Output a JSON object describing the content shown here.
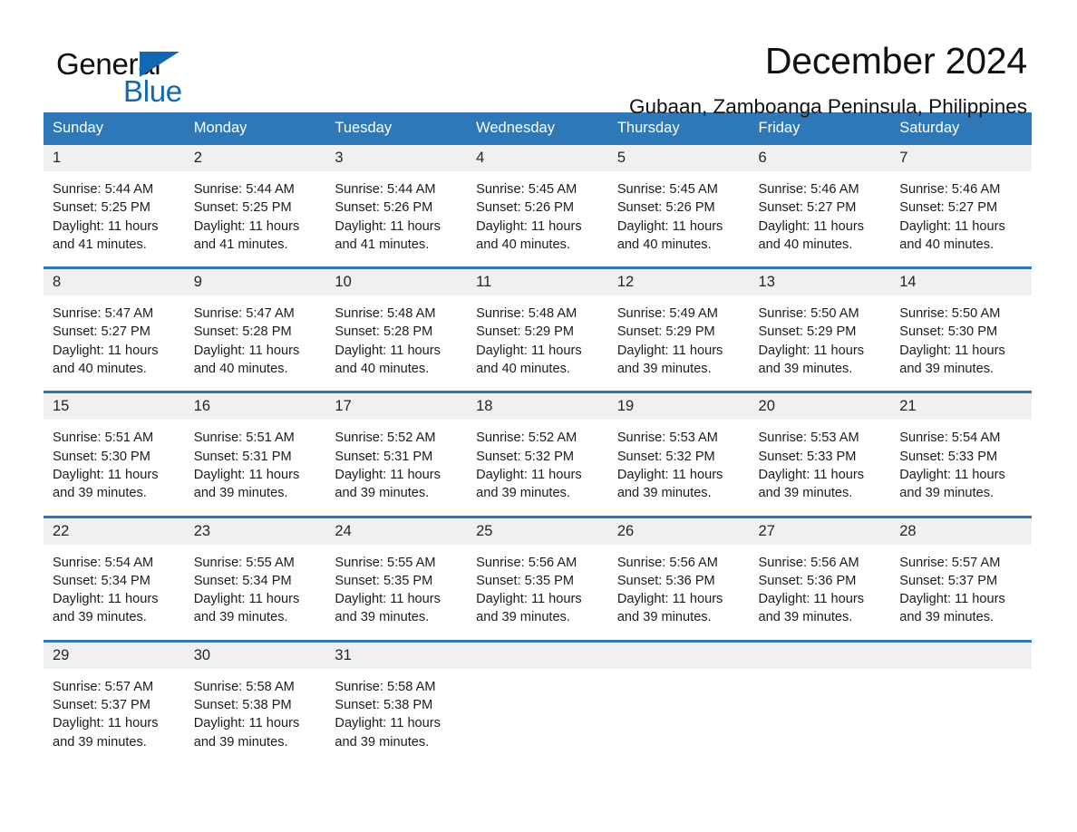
{
  "brand": {
    "word_one": "General",
    "word_two": "Blue",
    "accent_color": "#1268b3"
  },
  "header": {
    "title": "December 2024",
    "subtitle": "Gubaan, Zamboanga Peninsula, Philippines"
  },
  "theme": {
    "header_blue": "#2e78b8",
    "date_band_gray": "#f0f0f0",
    "text_color": "#1c1c1c"
  },
  "weekday_headers": [
    "Sunday",
    "Monday",
    "Tuesday",
    "Wednesday",
    "Thursday",
    "Friday",
    "Saturday"
  ],
  "weeks": [
    [
      {
        "day": "1",
        "sunrise": "Sunrise: 5:44 AM",
        "sunset": "Sunset: 5:25 PM",
        "daylight_line1": "Daylight: 11 hours",
        "daylight_line2": "and 41 minutes."
      },
      {
        "day": "2",
        "sunrise": "Sunrise: 5:44 AM",
        "sunset": "Sunset: 5:25 PM",
        "daylight_line1": "Daylight: 11 hours",
        "daylight_line2": "and 41 minutes."
      },
      {
        "day": "3",
        "sunrise": "Sunrise: 5:44 AM",
        "sunset": "Sunset: 5:26 PM",
        "daylight_line1": "Daylight: 11 hours",
        "daylight_line2": "and 41 minutes."
      },
      {
        "day": "4",
        "sunrise": "Sunrise: 5:45 AM",
        "sunset": "Sunset: 5:26 PM",
        "daylight_line1": "Daylight: 11 hours",
        "daylight_line2": "and 40 minutes."
      },
      {
        "day": "5",
        "sunrise": "Sunrise: 5:45 AM",
        "sunset": "Sunset: 5:26 PM",
        "daylight_line1": "Daylight: 11 hours",
        "daylight_line2": "and 40 minutes."
      },
      {
        "day": "6",
        "sunrise": "Sunrise: 5:46 AM",
        "sunset": "Sunset: 5:27 PM",
        "daylight_line1": "Daylight: 11 hours",
        "daylight_line2": "and 40 minutes."
      },
      {
        "day": "7",
        "sunrise": "Sunrise: 5:46 AM",
        "sunset": "Sunset: 5:27 PM",
        "daylight_line1": "Daylight: 11 hours",
        "daylight_line2": "and 40 minutes."
      }
    ],
    [
      {
        "day": "8",
        "sunrise": "Sunrise: 5:47 AM",
        "sunset": "Sunset: 5:27 PM",
        "daylight_line1": "Daylight: 11 hours",
        "daylight_line2": "and 40 minutes."
      },
      {
        "day": "9",
        "sunrise": "Sunrise: 5:47 AM",
        "sunset": "Sunset: 5:28 PM",
        "daylight_line1": "Daylight: 11 hours",
        "daylight_line2": "and 40 minutes."
      },
      {
        "day": "10",
        "sunrise": "Sunrise: 5:48 AM",
        "sunset": "Sunset: 5:28 PM",
        "daylight_line1": "Daylight: 11 hours",
        "daylight_line2": "and 40 minutes."
      },
      {
        "day": "11",
        "sunrise": "Sunrise: 5:48 AM",
        "sunset": "Sunset: 5:29 PM",
        "daylight_line1": "Daylight: 11 hours",
        "daylight_line2": "and 40 minutes."
      },
      {
        "day": "12",
        "sunrise": "Sunrise: 5:49 AM",
        "sunset": "Sunset: 5:29 PM",
        "daylight_line1": "Daylight: 11 hours",
        "daylight_line2": "and 39 minutes."
      },
      {
        "day": "13",
        "sunrise": "Sunrise: 5:50 AM",
        "sunset": "Sunset: 5:29 PM",
        "daylight_line1": "Daylight: 11 hours",
        "daylight_line2": "and 39 minutes."
      },
      {
        "day": "14",
        "sunrise": "Sunrise: 5:50 AM",
        "sunset": "Sunset: 5:30 PM",
        "daylight_line1": "Daylight: 11 hours",
        "daylight_line2": "and 39 minutes."
      }
    ],
    [
      {
        "day": "15",
        "sunrise": "Sunrise: 5:51 AM",
        "sunset": "Sunset: 5:30 PM",
        "daylight_line1": "Daylight: 11 hours",
        "daylight_line2": "and 39 minutes."
      },
      {
        "day": "16",
        "sunrise": "Sunrise: 5:51 AM",
        "sunset": "Sunset: 5:31 PM",
        "daylight_line1": "Daylight: 11 hours",
        "daylight_line2": "and 39 minutes."
      },
      {
        "day": "17",
        "sunrise": "Sunrise: 5:52 AM",
        "sunset": "Sunset: 5:31 PM",
        "daylight_line1": "Daylight: 11 hours",
        "daylight_line2": "and 39 minutes."
      },
      {
        "day": "18",
        "sunrise": "Sunrise: 5:52 AM",
        "sunset": "Sunset: 5:32 PM",
        "daylight_line1": "Daylight: 11 hours",
        "daylight_line2": "and 39 minutes."
      },
      {
        "day": "19",
        "sunrise": "Sunrise: 5:53 AM",
        "sunset": "Sunset: 5:32 PM",
        "daylight_line1": "Daylight: 11 hours",
        "daylight_line2": "and 39 minutes."
      },
      {
        "day": "20",
        "sunrise": "Sunrise: 5:53 AM",
        "sunset": "Sunset: 5:33 PM",
        "daylight_line1": "Daylight: 11 hours",
        "daylight_line2": "and 39 minutes."
      },
      {
        "day": "21",
        "sunrise": "Sunrise: 5:54 AM",
        "sunset": "Sunset: 5:33 PM",
        "daylight_line1": "Daylight: 11 hours",
        "daylight_line2": "and 39 minutes."
      }
    ],
    [
      {
        "day": "22",
        "sunrise": "Sunrise: 5:54 AM",
        "sunset": "Sunset: 5:34 PM",
        "daylight_line1": "Daylight: 11 hours",
        "daylight_line2": "and 39 minutes."
      },
      {
        "day": "23",
        "sunrise": "Sunrise: 5:55 AM",
        "sunset": "Sunset: 5:34 PM",
        "daylight_line1": "Daylight: 11 hours",
        "daylight_line2": "and 39 minutes."
      },
      {
        "day": "24",
        "sunrise": "Sunrise: 5:55 AM",
        "sunset": "Sunset: 5:35 PM",
        "daylight_line1": "Daylight: 11 hours",
        "daylight_line2": "and 39 minutes."
      },
      {
        "day": "25",
        "sunrise": "Sunrise: 5:56 AM",
        "sunset": "Sunset: 5:35 PM",
        "daylight_line1": "Daylight: 11 hours",
        "daylight_line2": "and 39 minutes."
      },
      {
        "day": "26",
        "sunrise": "Sunrise: 5:56 AM",
        "sunset": "Sunset: 5:36 PM",
        "daylight_line1": "Daylight: 11 hours",
        "daylight_line2": "and 39 minutes."
      },
      {
        "day": "27",
        "sunrise": "Sunrise: 5:56 AM",
        "sunset": "Sunset: 5:36 PM",
        "daylight_line1": "Daylight: 11 hours",
        "daylight_line2": "and 39 minutes."
      },
      {
        "day": "28",
        "sunrise": "Sunrise: 5:57 AM",
        "sunset": "Sunset: 5:37 PM",
        "daylight_line1": "Daylight: 11 hours",
        "daylight_line2": "and 39 minutes."
      }
    ],
    [
      {
        "day": "29",
        "sunrise": "Sunrise: 5:57 AM",
        "sunset": "Sunset: 5:37 PM",
        "daylight_line1": "Daylight: 11 hours",
        "daylight_line2": "and 39 minutes."
      },
      {
        "day": "30",
        "sunrise": "Sunrise: 5:58 AM",
        "sunset": "Sunset: 5:38 PM",
        "daylight_line1": "Daylight: 11 hours",
        "daylight_line2": "and 39 minutes."
      },
      {
        "day": "31",
        "sunrise": "Sunrise: 5:58 AM",
        "sunset": "Sunset: 5:38 PM",
        "daylight_line1": "Daylight: 11 hours",
        "daylight_line2": "and 39 minutes."
      },
      {
        "day": "",
        "sunrise": "",
        "sunset": "",
        "daylight_line1": "",
        "daylight_line2": ""
      },
      {
        "day": "",
        "sunrise": "",
        "sunset": "",
        "daylight_line1": "",
        "daylight_line2": ""
      },
      {
        "day": "",
        "sunrise": "",
        "sunset": "",
        "daylight_line1": "",
        "daylight_line2": ""
      },
      {
        "day": "",
        "sunrise": "",
        "sunset": "",
        "daylight_line1": "",
        "daylight_line2": ""
      }
    ]
  ]
}
